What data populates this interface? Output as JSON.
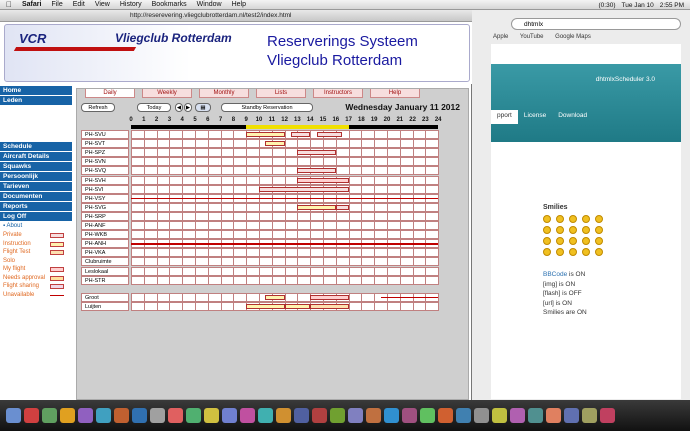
{
  "menubar": {
    "apple": "",
    "items": [
      "Safari",
      "File",
      "Edit",
      "View",
      "History",
      "Bookmarks",
      "Window",
      "Help"
    ],
    "right": [
      "(0:30)",
      "Tue Jan 10",
      "2:55 PM"
    ]
  },
  "browser": {
    "url": "http://reserevering.vliegclubrotterdam.nl/test2/index.html"
  },
  "bg_window": {
    "search_text": "dhtmlx",
    "bookmarks": [
      "Apple",
      "YouTube",
      "Google Maps"
    ],
    "brand": "dhtmlxScheduler 3.0",
    "tabs": [
      "pport",
      "License",
      "Download"
    ],
    "smilies_title": "Smilies",
    "options": [
      {
        "name": "BBCode",
        "state": "is ON"
      },
      {
        "name": "[img]",
        "state": "is ON"
      },
      {
        "name": "[flash]",
        "state": "is OFF"
      },
      {
        "name": "[url]",
        "state": "is ON"
      },
      {
        "name": "Smilies",
        "state": "are ON"
      }
    ]
  },
  "header": {
    "logo_left": "VCR",
    "logo_right": "Vliegclub Rotterdam",
    "title_line1": "Reserverings Systeem",
    "title_line2": "Vliegclub Rotterdam"
  },
  "sidebar": {
    "top": [
      "Home",
      "Leden"
    ],
    "menu": [
      "Schedule",
      "Aircraft Details",
      "Squawks",
      "Persoonlijk",
      "Tarieven",
      "Documenten",
      "Reports",
      "Log Off"
    ],
    "about": "About",
    "legend": [
      {
        "label": "Private",
        "color": "#f7dede"
      },
      {
        "label": "Instruction",
        "color": "#fff3b0"
      },
      {
        "label": "Flight Test",
        "color": "#fde0b0"
      },
      {
        "label": "Solo",
        "color": ""
      },
      {
        "label": "My flight",
        "color": "#ffd0d0"
      },
      {
        "label": "Needs approval",
        "color": "#ffe0a0"
      },
      {
        "label": "Flight sharing",
        "color": "#f0d8e8"
      },
      {
        "label": "Unavailable",
        "color": "#c00000"
      }
    ]
  },
  "schedule": {
    "tabs": [
      "Daily",
      "Weekly",
      "Monthly",
      "Lists",
      "Instructors",
      "Help"
    ],
    "active_tab": 0,
    "refresh": "Refresh",
    "today": "Today",
    "standby": "Standby Reservation",
    "date": "Wednesday January 11 2012",
    "hours": [
      "0",
      "1",
      "2",
      "3",
      "4",
      "5",
      "6",
      "7",
      "8",
      "9",
      "10",
      "11",
      "12",
      "13",
      "14",
      "15",
      "16",
      "17",
      "18",
      "19",
      "20",
      "21",
      "22",
      "23",
      "24"
    ],
    "aircraft": [
      "PH-SVU",
      "PH-SVT",
      "PH-SPZ",
      "PH-SVN",
      "PH-SVQ",
      "PH-SVH",
      "PH-SVI",
      "PH-VSY",
      "PH-SVG",
      "PH-SRP",
      "PH-ANF",
      "PH-WKB",
      "PH-ANH",
      "PH-VKA",
      "Clubruimte",
      "Leslokaal",
      "PH-STR"
    ],
    "rooms": [
      "Groot",
      "Luijten"
    ],
    "events": [
      {
        "row": 0,
        "start": 9,
        "end": 12,
        "kind": "instruction"
      },
      {
        "row": 0,
        "start": 12.5,
        "end": 14,
        "kind": "private"
      },
      {
        "row": 0,
        "start": 14.5,
        "end": 16.5,
        "kind": "private"
      },
      {
        "row": 1,
        "start": 10.5,
        "end": 12,
        "kind": "instruction"
      },
      {
        "row": 2,
        "start": 13,
        "end": 16,
        "kind": "private"
      },
      {
        "row": 4,
        "start": 13,
        "end": 16,
        "kind": "private"
      },
      {
        "row": 5,
        "start": 13,
        "end": 17,
        "kind": "myflight"
      },
      {
        "row": 6,
        "start": 10,
        "end": 17,
        "kind": "private"
      },
      {
        "row": 8,
        "start": 13,
        "end": 16,
        "kind": "instruction"
      },
      {
        "row": 8,
        "start": 16,
        "end": 17,
        "kind": "private"
      },
      {
        "r": "Groot",
        "row": 17,
        "start": 10.5,
        "end": 12,
        "kind": "instruction"
      },
      {
        "row": 17,
        "start": 14,
        "end": 17,
        "kind": "myflight"
      },
      {
        "row": 18,
        "start": 9,
        "end": 12,
        "kind": "instruction"
      },
      {
        "row": 18,
        "start": 12,
        "end": 14,
        "kind": "instruction"
      },
      {
        "row": 18,
        "start": 14,
        "end": 17,
        "kind": "flighttest"
      }
    ],
    "unavailable_rows": [
      7,
      12
    ],
    "unavailable_partial": [
      {
        "row": 17,
        "start": 19.5,
        "end": 24
      }
    ],
    "daylight": {
      "start": 9,
      "end": 17
    }
  }
}
